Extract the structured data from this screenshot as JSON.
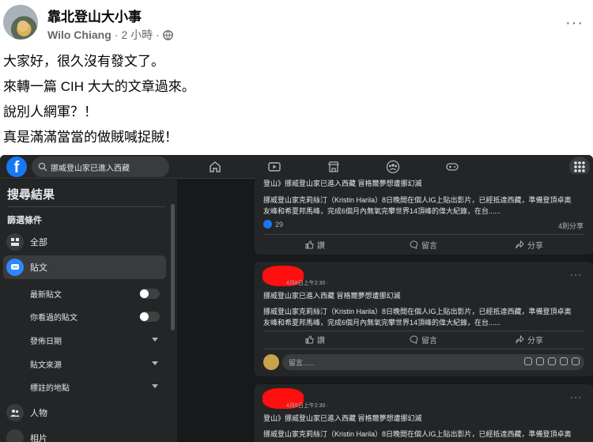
{
  "post": {
    "group_name": "靠北登山大小事",
    "author": "Wilo Chiang",
    "time": "2 小時",
    "separator": "·",
    "more": "···",
    "lines": [
      "大家好，很久沒有發文了。",
      "來轉一篇 CIH 大大的文章過來。",
      "說別人網軍？！",
      "真是滿滿當當的做賊喊捉賊！"
    ]
  },
  "screenshot": {
    "search_text": "挪威登山家已進入西藏",
    "sidebar": {
      "title": "搜尋結果",
      "filter_label": "篩選條件",
      "items": [
        {
          "label": "全部",
          "icon": "grid-icon"
        },
        {
          "label": "貼文",
          "icon": "post-icon"
        }
      ],
      "sub_items": [
        {
          "label": "最新貼文",
          "control": "toggle"
        },
        {
          "label": "你看過的貼文",
          "control": "toggle"
        },
        {
          "label": "發佈日期",
          "control": "caret"
        },
        {
          "label": "貼文來源",
          "control": "caret"
        },
        {
          "label": "標註的地點",
          "control": "caret"
        }
      ],
      "bottom_items": [
        {
          "label": "人物",
          "icon": "people-icon"
        },
        {
          "label": "相片",
          "icon": "photo-icon"
        }
      ]
    },
    "card1": {
      "line1": "登山》挪威登山家已進入西藏 冒格爾夢想遭挪幻滅",
      "body1": "挪威登山家克莉絲汀（Kristin Harila）8日晚間在個人IG上貼出影片，已經抵達西藏，準備登頂卓奧",
      "body2": "友峰和希夏邦馬峰，完成6個月內無氧完攀世界14頂峰的偉大紀錄，在台......",
      "likes": "29",
      "shares": "4則分享",
      "like": "讚",
      "comment": "留言",
      "share": "分享"
    },
    "card2": {
      "timestamp": "4月8日上午2:30 · ",
      "line1": "挪威登山家已進入西藏 冒格爾夢想遭挪幻滅",
      "body1": "挪威登山家克莉絲汀（Kristin Harila）8日晚間在個人IG上貼出影片，已經抵達西藏，準備登頂卓奧",
      "body2": "友峰和希夏邦馬峰，完成6個月內無氧完攀世界14頂峰的偉大紀錄，在台......",
      "like": "讚",
      "comment": "留言",
      "share": "分享",
      "comment_placeholder": "留言......"
    },
    "card3": {
      "timestamp": "4月8日上午2:30 · ",
      "line1": "登山》挪威登山家已進入西藏 冒格爾夢想遭挪幻滅",
      "body1": "挪威登山家克莉絲汀（Kristin Harila）8日晚間在個人IG上貼出影片，已經抵達西藏，準備登頂卓奧"
    }
  },
  "colors": {
    "fb_blue": "#1877f2",
    "dark_bg": "#18191a",
    "card_bg": "#242526",
    "redaction": "#ff0f0f"
  }
}
